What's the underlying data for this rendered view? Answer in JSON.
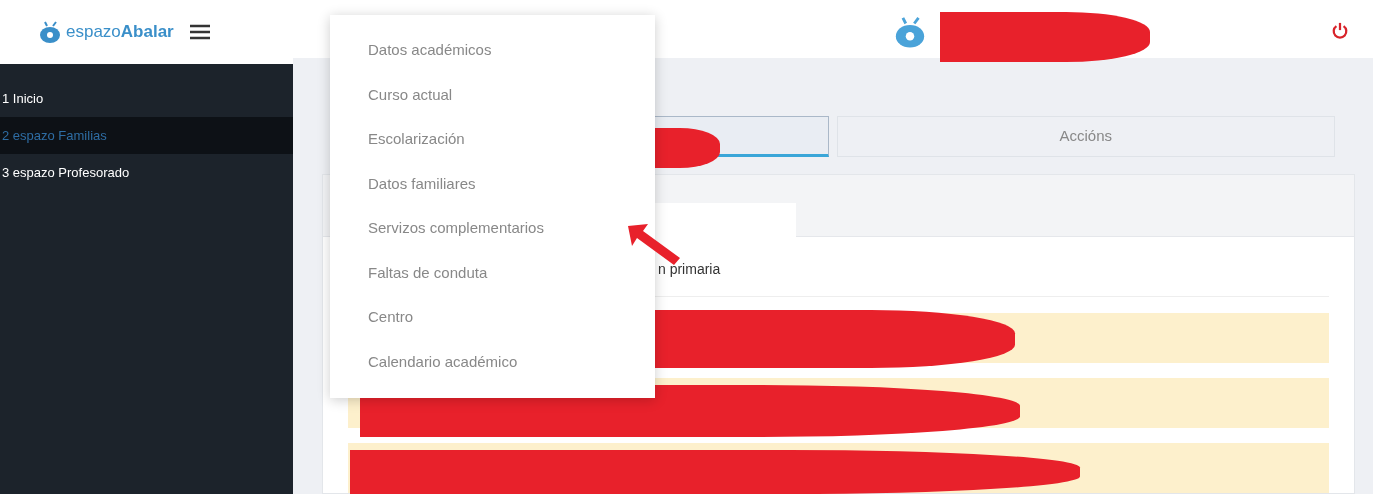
{
  "logo": {
    "text_light": "espazo",
    "text_bold": "Abalar"
  },
  "sidebar": {
    "items": [
      {
        "label": "1 Inicio",
        "selected": false
      },
      {
        "label": "2 espazo Familias",
        "selected": true
      },
      {
        "label": "3 espazo Profesorado",
        "selected": false
      }
    ]
  },
  "tabs": [
    {
      "selected": true
    },
    {
      "label": "Accións",
      "selected": false
    }
  ],
  "card": {
    "line": "n primaria"
  },
  "dropdown": {
    "items": [
      "Datos académicos",
      "Curso actual",
      "Escolarización",
      "Datos familiares",
      "Servizos complementarios",
      "Faltas de conduta",
      "Centro",
      "Calendario académico"
    ]
  }
}
